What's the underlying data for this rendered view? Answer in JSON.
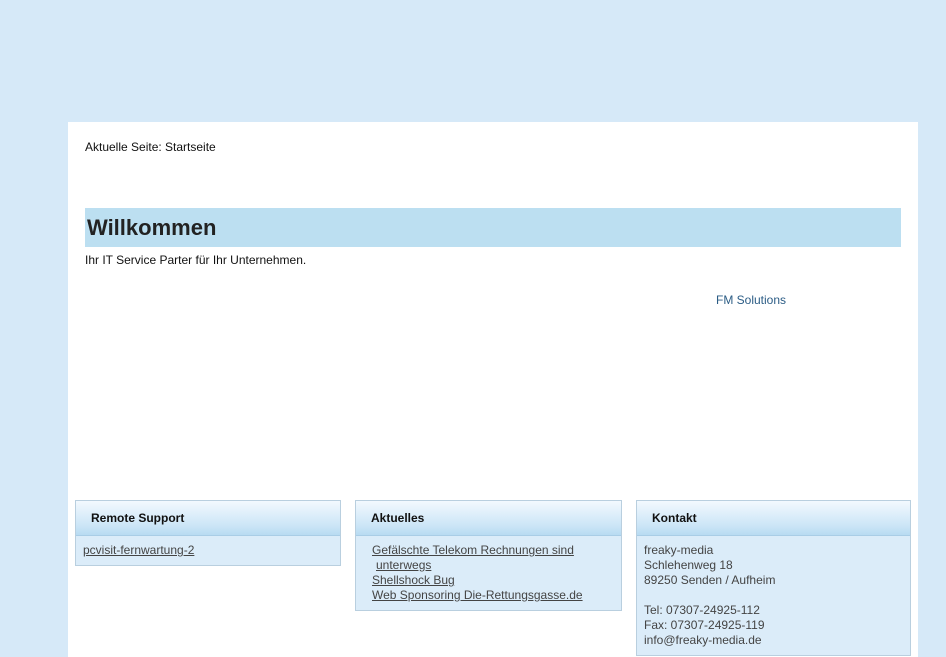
{
  "breadcrumb": "Aktuelle Seite: Startseite",
  "welcome": {
    "title": "Willkommen",
    "tagline": "Ihr IT Service Parter für Ihr Unternehmen."
  },
  "fm_link": "FM Solutions",
  "remote_support": {
    "title": "Remote Support",
    "link": "pcvisit-fernwartung-2"
  },
  "news": {
    "title": "Aktuelles",
    "items": [
      {
        "line1": "Gefälschte Telekom Rechnungen sind",
        "line2": "unterwegs"
      },
      {
        "line1": "Shellshock Bug"
      },
      {
        "line1": "Web Sponsoring Die-Rettungsgasse.de"
      }
    ]
  },
  "contact": {
    "title": "Kontakt",
    "company": "freaky-media",
    "street": "Schlehenweg 18",
    "city": "89250 Senden / Aufheim",
    "tel": "Tel: 07307-24925-112",
    "fax": "Fax: 07307-24925-119",
    "email": "info@freaky-media.de"
  },
  "colors": {
    "background": "#d6e9f8",
    "welcome_bar": "#bcdff1",
    "box_bg": "#dbecf9",
    "link": "#2b5c85"
  }
}
